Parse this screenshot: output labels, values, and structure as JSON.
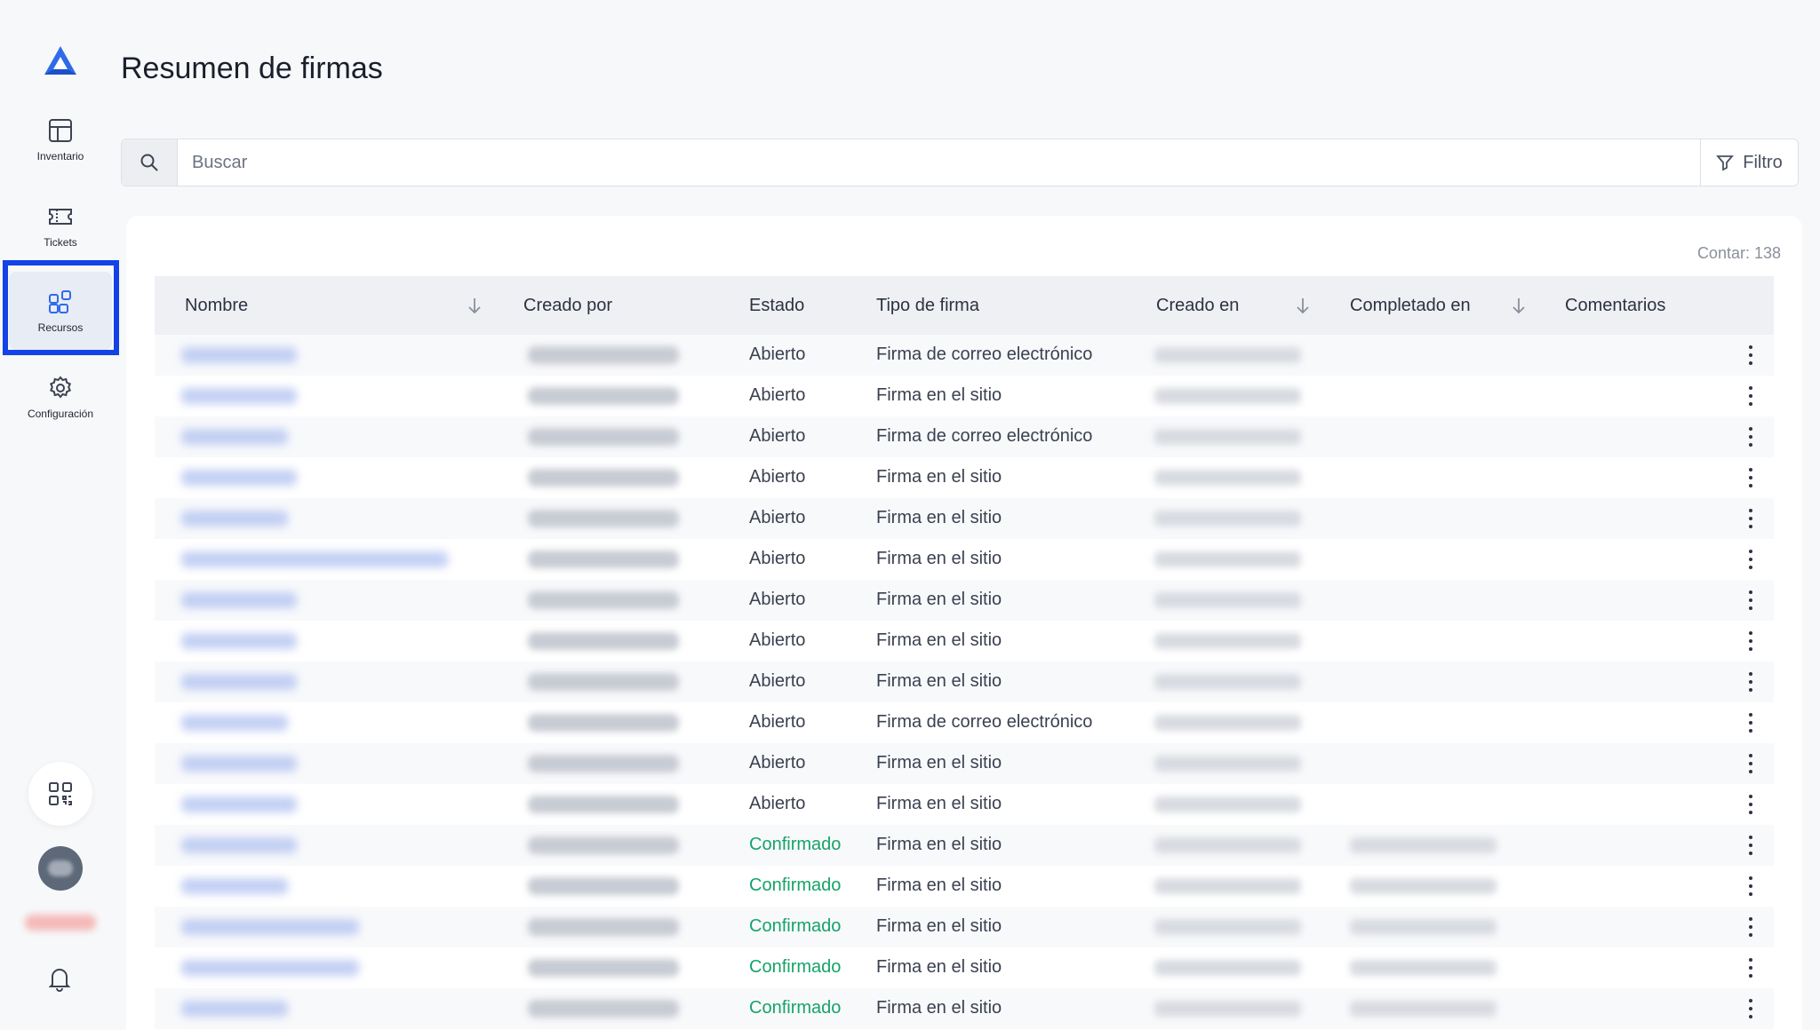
{
  "page": {
    "title": "Resumen de firmas"
  },
  "sidebar": {
    "items": [
      {
        "label": "Inventario",
        "icon": "grid-icon"
      },
      {
        "label": "Tickets",
        "icon": "ticket-icon"
      },
      {
        "label": "Recursos",
        "icon": "resources-icon",
        "active": true
      },
      {
        "label": "Configuración",
        "icon": "gear-icon"
      }
    ]
  },
  "search": {
    "placeholder": "Buscar",
    "value": "",
    "filter_label": "Filtro"
  },
  "table": {
    "count_label": "Contar: 138",
    "columns": [
      "Nombre",
      "Creado por",
      "Estado",
      "Tipo de firma",
      "Creado en",
      "Completado en",
      "Comentarios"
    ],
    "rows": [
      {
        "estado": "Abierto",
        "tipo": "Firma de correo electrónico"
      },
      {
        "estado": "Abierto",
        "tipo": "Firma en el sitio"
      },
      {
        "estado": "Abierto",
        "tipo": "Firma de correo electrónico"
      },
      {
        "estado": "Abierto",
        "tipo": "Firma en el sitio"
      },
      {
        "estado": "Abierto",
        "tipo": "Firma en el sitio"
      },
      {
        "estado": "Abierto",
        "tipo": "Firma en el sitio"
      },
      {
        "estado": "Abierto",
        "tipo": "Firma en el sitio"
      },
      {
        "estado": "Abierto",
        "tipo": "Firma en el sitio"
      },
      {
        "estado": "Abierto",
        "tipo": "Firma en el sitio"
      },
      {
        "estado": "Abierto",
        "tipo": "Firma de correo electrónico"
      },
      {
        "estado": "Abierto",
        "tipo": "Firma en el sitio"
      },
      {
        "estado": "Abierto",
        "tipo": "Firma en el sitio"
      },
      {
        "estado": "Confirmado",
        "tipo": "Firma en el sitio"
      },
      {
        "estado": "Confirmado",
        "tipo": "Firma en el sitio"
      },
      {
        "estado": "Confirmado",
        "tipo": "Firma en el sitio"
      },
      {
        "estado": "Confirmado",
        "tipo": "Firma en el sitio"
      },
      {
        "estado": "Confirmado",
        "tipo": "Firma en el sitio"
      }
    ]
  },
  "colors": {
    "accent": "#1342e6",
    "logo": "#2f6be8",
    "confirmed": "#16a368"
  }
}
